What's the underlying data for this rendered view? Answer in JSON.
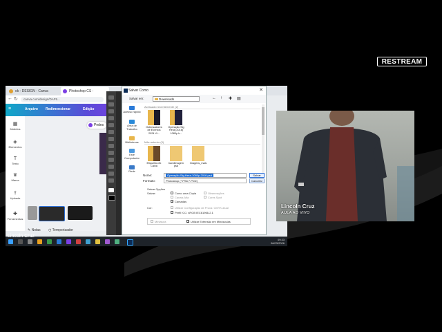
{
  "brand": {
    "restream_label": "RESTREAM"
  },
  "browser": {
    "tabs": [
      {
        "label": "ok - DESIGN - Canva",
        "color": "#e0a030"
      },
      {
        "label": "Photoshop CS - Photoshop BR...",
        "color": "#7b3fe4"
      }
    ],
    "address": "canva.com/design/DAF5..."
  },
  "canva": {
    "menu": [
      "Arquivo",
      "Redimensionar",
      "Edição"
    ],
    "sidebar": [
      {
        "label": "Modelos",
        "icon": "grid-icon"
      },
      {
        "label": "Elementos",
        "icon": "shapes-icon"
      },
      {
        "label": "Texto",
        "icon": "text-icon"
      },
      {
        "label": "Marca",
        "icon": "crown-icon"
      },
      {
        "label": "Uploads",
        "icon": "upload-icon"
      },
      {
        "label": "Ferramentas",
        "icon": "tools-icon"
      }
    ],
    "pill": "Pedes",
    "footer": {
      "notes": "Notas",
      "timer": "Temporizador"
    }
  },
  "dialog": {
    "title": "Salvar Como",
    "save_in_label": "Salvar em:",
    "folder": "Downloads",
    "places": [
      "Acesso rápido",
      "Área de Trabalho",
      "Bibliotecas",
      "Este Computador",
      "Rede"
    ],
    "section_recent": "Acessado recentemente (2)",
    "section_earlier": "Mês anterior (3)",
    "files_recent": [
      {
        "label": "Ostensadores de Eventos 2024 Vi..."
      },
      {
        "label": "Operação Sig Hera (2016) 1080p h..."
      }
    ],
    "files_earlier": [
      {
        "label": "Etiquetas 8x Caixa"
      },
      {
        "label": "bandimagem psd"
      },
      {
        "label": "Imagens_mais"
      }
    ],
    "name_label": "Nome:",
    "name_value": "Operação-Sig-Hera-1080p-2016.psd",
    "format_label": "Formato:",
    "format_value": "Photoshop (*.PSD;*.PDD)",
    "save_button": "Salvar",
    "cancel_button": "Cancelar",
    "save_options_label": "Salvar Opções",
    "save_label": "Salvar:",
    "as_copy": "Como uma Cópia",
    "notes": "Observações",
    "alpha": "Canais Alfa",
    "spot": "Cores Spot",
    "layers": "Camadas",
    "color_label": "Cor:",
    "proof": "Utilizar Configuração de Prova: CMYK atual",
    "icc": "Perfil ICC: sRGB IEC61966-2.1",
    "thumbnail": "Miniatura",
    "lower_ext": "Utilizar Extensão em Minúsculas"
  },
  "taskbar": {
    "time": "09:33",
    "date": "06/03/2026"
  },
  "webcam": {
    "name": "Lincoln Cruz",
    "subtitle": "AULA AO VIVO"
  },
  "overlay_name": "Lincoln Cruz"
}
